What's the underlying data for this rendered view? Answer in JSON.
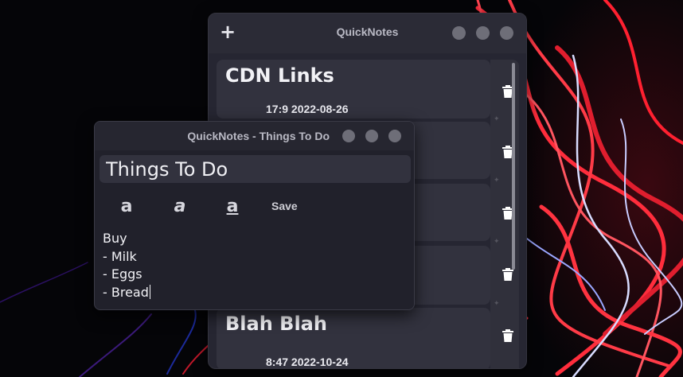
{
  "colors": {
    "window_bg": "#262632",
    "card_bg": "#32323e",
    "text": "#f2f2f6",
    "control_dot": "#6e6e78"
  },
  "main_window": {
    "title": "QuickNotes",
    "add_icon": "+",
    "notes": [
      {
        "title": "CDN Links",
        "date": "17:9 2022-08-26"
      },
      {
        "title": "",
        "date": ""
      },
      {
        "title": "",
        "date": ""
      },
      {
        "title": "",
        "date": ""
      },
      {
        "title": "Blah Blah",
        "date": "8:47 2022-10-24"
      }
    ]
  },
  "editor_window": {
    "title": "QuickNotes - Things To Do",
    "note_title": "Things To Do",
    "toolbar": {
      "bold_glyph": "a",
      "italic_glyph": "a",
      "underline_glyph": "a",
      "save_label": "Save"
    },
    "body_lines": [
      "Buy",
      "- Milk",
      "- Eggs",
      "- Bread"
    ]
  }
}
